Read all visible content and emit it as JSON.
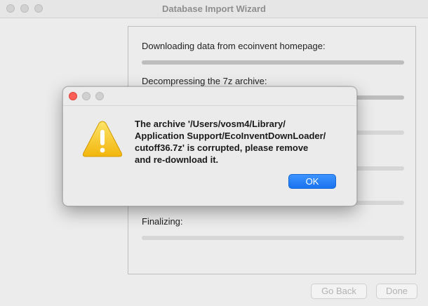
{
  "window": {
    "title": "Database Import Wizard"
  },
  "steps": [
    {
      "label": "Downloading data from ecoinvent homepage:",
      "progress": 1.0
    },
    {
      "label": "Decompressing the 7z archive:",
      "progress": 1.0
    },
    {
      "label": "",
      "progress": 0
    },
    {
      "label": "",
      "progress": 0
    },
    {
      "label": "",
      "progress": 0
    },
    {
      "label": "Finalizing:",
      "progress": 0
    }
  ],
  "buttons": {
    "back": "Go Back",
    "done": "Done"
  },
  "dialog": {
    "message_lines": [
      "The archive '/Users/vosm4/Library/",
      "Application Support/EcoInventDownLoader/",
      "cutoff36.7z' is corrupted, please remove",
      "and re-download it."
    ],
    "ok": "OK",
    "icon": "warning-icon"
  }
}
